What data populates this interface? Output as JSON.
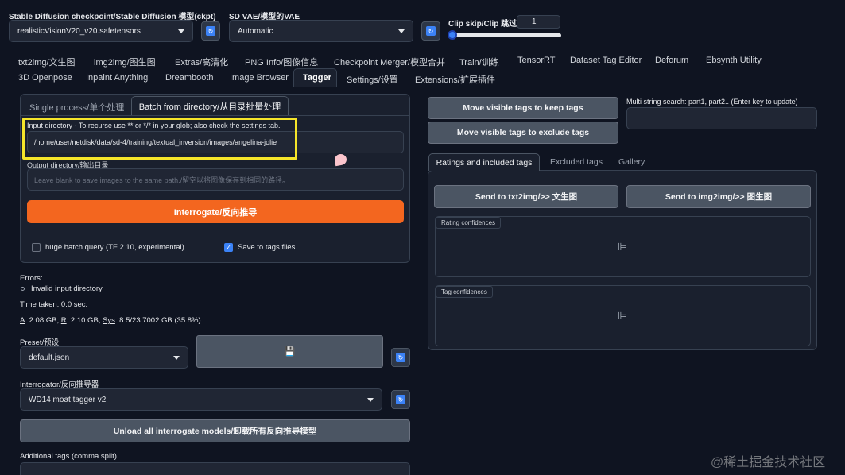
{
  "top": {
    "checkpoint_label": "Stable Diffusion checkpoint/Stable Diffusion 模型(ckpt)",
    "checkpoint_value": "realisticVisionV20_v20.safetensors",
    "vae_label": "SD VAE/模型的VAE",
    "vae_value": "Automatic",
    "clip_label": "Clip skip/Clip 跳过层",
    "clip_value": "1",
    "refresh_glyph": "↻"
  },
  "tabs_row1": [
    "txt2img/文生图",
    "img2img/图生图",
    "Extras/高清化",
    "PNG Info/图像信息",
    "Checkpoint Merger/模型合并",
    "Train/训练",
    "TensorRT",
    "Dataset Tag Editor",
    "Deforum",
    "Ebsynth Utility"
  ],
  "tabs_row2": [
    "3D Openpose",
    "Inpaint Anything",
    "Dreambooth",
    "Image Browser",
    "Tagger",
    "Settings/设置",
    "Extensions/扩展插件"
  ],
  "left": {
    "subtab_single": "Single process/单个处理",
    "subtab_batch": "Batch from directory/从目录批量处理",
    "input_dir_label": "Input directory - To recurse use ** or */* in your glob; also check the settings tab.",
    "input_dir_value": "/home/user/netdisk/data/sd-4/training/textual_inversion/images/angelina-jolie",
    "output_dir_label": "Output directory/输出目录",
    "output_dir_placeholder": "Leave blank to save images to the same path./留空以将图像保存到相同的路径。",
    "interrogate_button": "Interrogate/反向推导",
    "huge_batch_label": "huge batch query (TF 2.10, experimental)",
    "save_tags_label": "Save to tags files",
    "check_glyph": "✓",
    "errors_title": "Errors:",
    "error_item": "Invalid input directory",
    "time_taken": "Time taken: 0.0 sec.",
    "mem_a_key": "A",
    "mem_a_val": ": 2.08 GB, ",
    "mem_r_key": "R",
    "mem_r_val": ": 2.10 GB, ",
    "mem_sys_key": "Sys",
    "mem_sys_val": ": 8.5/23.7002 GB (35.8%)",
    "preset_label": "Preset/预设",
    "preset_value": "default.json",
    "save_glyph": "💾",
    "interrogator_label": "Interrogator/反向推导器",
    "interrogator_value": "WD14 moat tagger v2",
    "unload_button": "Unload all interrogate models/卸载所有反向推导模型",
    "additional_tags_label": "Additional tags (comma split)"
  },
  "right": {
    "move_keep": "Move visible tags to keep tags",
    "move_exclude": "Move visible tags to exclude tags",
    "multi_search_label": "Multi string search: part1, part2.. (Enter key to update)",
    "tab_ratings": "Ratings and included tags",
    "tab_excluded": "Excluded tags",
    "tab_gallery": "Gallery",
    "send_txt2img": "Send to txt2img/>> 文生图",
    "send_img2img": "Send to img2img/>> 图生图",
    "rating_conf": "Rating confidences",
    "tag_conf": "Tag confidences",
    "chart_glyph": "⊫"
  },
  "watermark": "@稀土掘金技术社区",
  "colors": {
    "accent_orange": "#f97316",
    "highlight_yellow": "#f5e52a",
    "accent_blue": "#3b82f6"
  }
}
